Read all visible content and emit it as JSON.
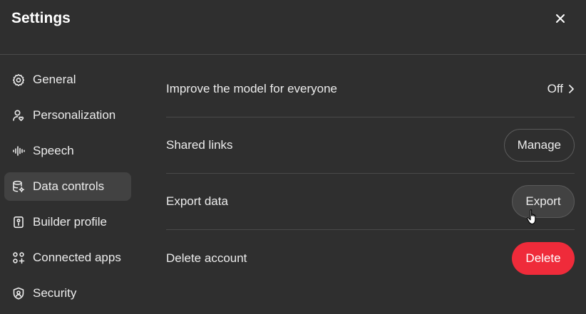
{
  "header": {
    "title": "Settings",
    "close_icon": "close-icon"
  },
  "sidebar": {
    "items": [
      {
        "label": "General",
        "icon": "gear-icon",
        "active": false
      },
      {
        "label": "Personalization",
        "icon": "user-heart-icon",
        "active": false
      },
      {
        "label": "Speech",
        "icon": "waveform-icon",
        "active": false
      },
      {
        "label": "Data controls",
        "icon": "database-gear-icon",
        "active": true
      },
      {
        "label": "Builder profile",
        "icon": "id-card-icon",
        "active": false
      },
      {
        "label": "Connected apps",
        "icon": "apps-grid-icon",
        "active": false
      },
      {
        "label": "Security",
        "icon": "shield-icon",
        "active": false
      }
    ]
  },
  "data_controls": {
    "rows": [
      {
        "label": "Improve the model for everyone",
        "value": "Off"
      },
      {
        "label": "Shared links",
        "button": "Manage"
      },
      {
        "label": "Export data",
        "button": "Export"
      },
      {
        "label": "Delete account",
        "button": "Delete"
      }
    ]
  },
  "colors": {
    "background": "#2f2f2f",
    "active_nav": "#424242",
    "divider": "#4a4a4a",
    "danger": "#ef2b3a"
  }
}
